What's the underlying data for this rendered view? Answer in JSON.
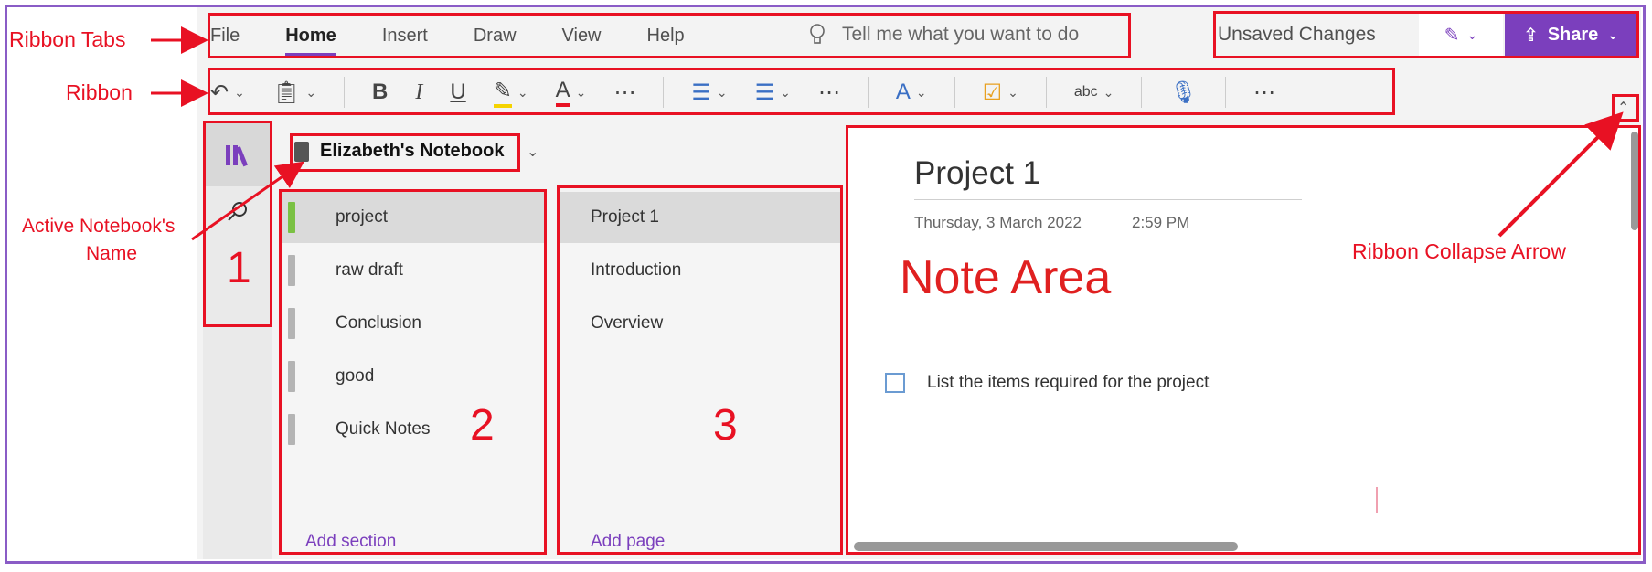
{
  "ribbon_tabs": {
    "items": [
      {
        "label": "File",
        "active": false
      },
      {
        "label": "Home",
        "active": true
      },
      {
        "label": "Insert",
        "active": false
      },
      {
        "label": "Draw",
        "active": false
      },
      {
        "label": "View",
        "active": false
      },
      {
        "label": "Help",
        "active": false
      }
    ],
    "tell_me_placeholder": "Tell me what you want to do"
  },
  "header_right": {
    "status": "Unsaved Changes",
    "share_label": "Share"
  },
  "ribbon_icons": [
    "undo-icon",
    "clipboard-icon",
    "bold-icon",
    "italic-icon",
    "underline-icon",
    "highlighter-icon",
    "font-color-icon",
    "more-icon",
    "bullet-list-icon",
    "numbered-list-icon",
    "more-icon",
    "styles-icon",
    "tag-icon",
    "spelling-icon",
    "dictate-icon",
    "more-icon"
  ],
  "notebook": {
    "name": "Elizabeth's Notebook"
  },
  "sections": {
    "items": [
      {
        "label": "project",
        "selected": true,
        "color": "#7ac143"
      },
      {
        "label": "raw draft",
        "selected": false
      },
      {
        "label": "Conclusion",
        "selected": false
      },
      {
        "label": "good",
        "selected": false
      },
      {
        "label": "Quick Notes",
        "selected": false
      }
    ],
    "add_label": "Add section"
  },
  "pages": {
    "items": [
      {
        "label": "Project 1",
        "selected": true
      },
      {
        "label": "Introduction",
        "selected": false
      },
      {
        "label": "Overview",
        "selected": false
      }
    ],
    "add_label": "Add page"
  },
  "note": {
    "title": "Project 1",
    "date": "Thursday, 3 March 2022",
    "time": "2:59 PM",
    "todo_text": "List the items required for the project"
  },
  "annotations": {
    "ribbon_tabs": "Ribbon Tabs",
    "ribbon": "Ribbon",
    "active_notebook_line1": "Active Notebook's",
    "active_notebook_line2": "Name",
    "note_area": "Note Area",
    "collapse_arrow": "Ribbon Collapse Arrow",
    "num1": "1",
    "num2": "2",
    "num3": "3"
  },
  "colors": {
    "accent": "#7b3fbd",
    "annotation": "#e81123",
    "frame": "#8a5cc6"
  }
}
